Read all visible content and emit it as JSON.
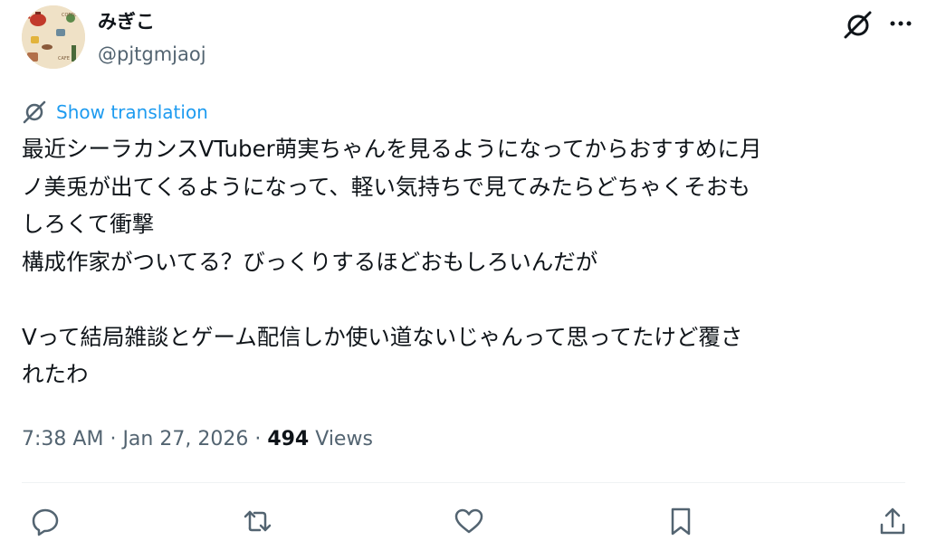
{
  "author": {
    "display_name": "みぎこ",
    "handle": "@pjtgmjaoj",
    "avatar_icon": "cafe-illustration-avatar",
    "avatar_text_1": "COFFEE",
    "avatar_text_2": "CAFE"
  },
  "header_icons": [
    "grok-icon",
    "more-icon"
  ],
  "translation": {
    "icon": "globe-icon",
    "label": "Show translation"
  },
  "tweet": {
    "lines": [
      "最近シーラカンスVTuber萌実ちゃんを見るようになってからおすすめに月",
      "ノ美兎が出てくるようになって、軽い気持ちで見てみたらどちゃくそおも",
      "しろくて衝撃",
      "構成作家がついてる？びっくりするほどおもしろいんだが",
      "",
      "Vって結局雑談とゲーム配信しか使い道ないじゃんって思ってたけど覆さ",
      "れたわ"
    ]
  },
  "meta": {
    "time": "7:38 AM",
    "separator": "·",
    "date": "Jan 27, 2026",
    "views_count": "494",
    "views_label": "Views"
  },
  "actions": [
    "reply-icon",
    "retweet-icon",
    "like-icon",
    "bookmark-icon",
    "share-icon"
  ],
  "colors": {
    "accent": "#1d9bf0",
    "secondary_text": "#536471",
    "primary_text": "#0f1419",
    "divider": "#eff3f4"
  }
}
